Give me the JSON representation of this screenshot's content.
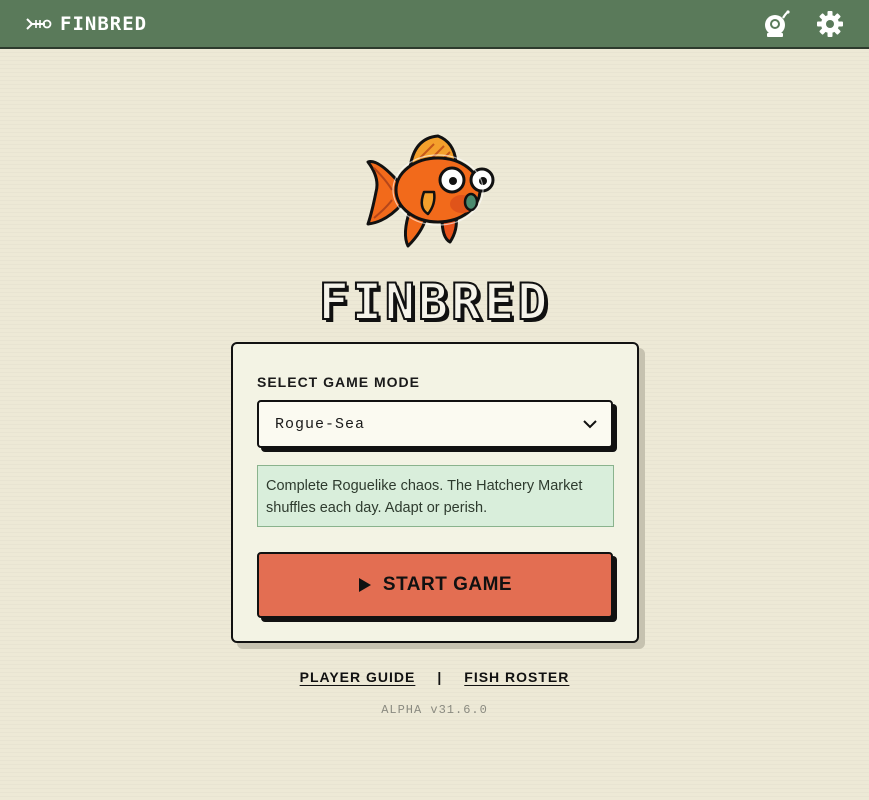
{
  "header": {
    "brand_name": "FINBRED",
    "brand_icon": "fish-skeleton-icon",
    "actions": [
      {
        "name": "diver-helmet-icon"
      },
      {
        "name": "gear-icon"
      }
    ]
  },
  "hero": {
    "mascot": "goldfish-mascot",
    "title": "FINBRED"
  },
  "mode_card": {
    "label": "SELECT GAME MODE",
    "selected_mode": "Rogue-Sea",
    "description": "Complete Roguelike chaos. The Hatchery Market shuffles each day. Adapt or perish.",
    "start_label": "START GAME"
  },
  "footer": {
    "links": [
      "PLAYER GUIDE",
      "FISH ROSTER"
    ],
    "separator": "|",
    "version": "ALPHA v31.6.0"
  },
  "colors": {
    "topbar": "#5a7a5a",
    "background": "#ede9d6",
    "card": "#f3f3e4",
    "start_button": "#e36e52",
    "description_bg": "#d9eedb",
    "fish_orange": "#f26a1b"
  }
}
